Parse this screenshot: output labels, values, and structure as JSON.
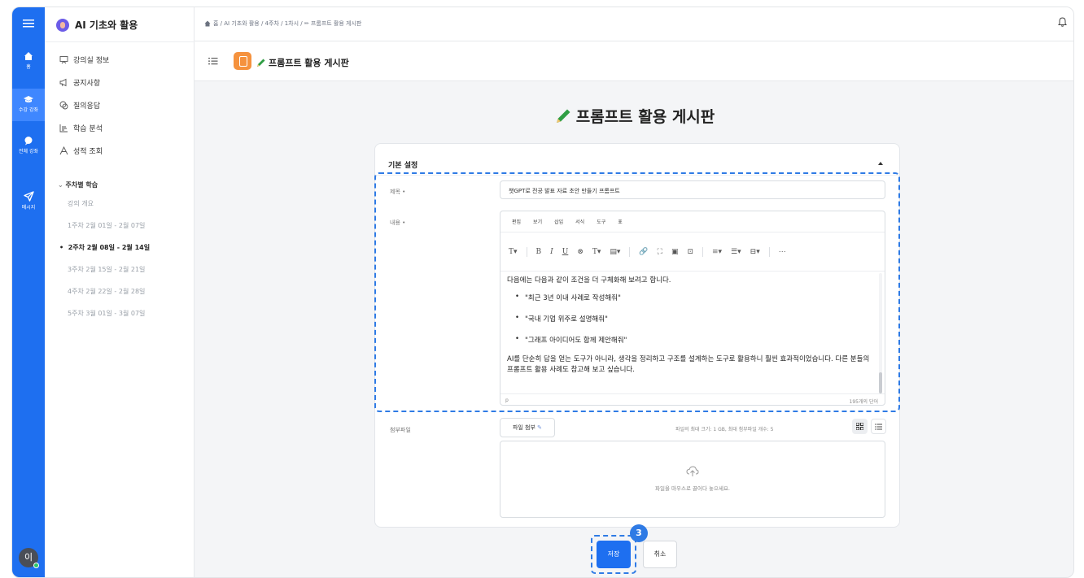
{
  "rail": {
    "items": [
      {
        "icon": "menu-icon",
        "label": ""
      },
      {
        "icon": "home-icon",
        "label": "홈"
      },
      {
        "icon": "graduation-cap-icon",
        "label": "수강 강좌"
      },
      {
        "icon": "chat-icon",
        "label": "전체 강좌"
      },
      {
        "icon": "send-icon",
        "label": "메시지"
      }
    ],
    "avatar_initial": "이"
  },
  "sidebar": {
    "course_title": "AI 기초와 활용",
    "menu": [
      {
        "icon": "classroom-icon",
        "label": "강의실 정보"
      },
      {
        "icon": "megaphone-icon",
        "label": "공지사항"
      },
      {
        "icon": "qa-icon",
        "label": "질의응답"
      },
      {
        "icon": "analytics-icon",
        "label": "학습 분석"
      },
      {
        "icon": "grade-icon",
        "label": "성적 조회"
      }
    ],
    "week_heading": "주차별 학습",
    "weeks": [
      {
        "label": "강의 개요",
        "current": false
      },
      {
        "label": "1주차 2월 01일 - 2월 07일",
        "current": false
      },
      {
        "label": "2주차 2월 08일 - 2월 14일",
        "current": true
      },
      {
        "label": "3주차 2월 15일 - 2월 21일",
        "current": false
      },
      {
        "label": "4주차 2월 22일 - 2월 28일",
        "current": false
      },
      {
        "label": "5주차 3월 01일 - 3월 07일",
        "current": false
      }
    ]
  },
  "topbar": {
    "breadcrumb": "홈 / AI 기초와 활용 / 4주차 / 1차시 / ✏ 프롬프트 활용 게시판"
  },
  "board": {
    "name": "프롬프트 활용 게시판",
    "page_title": "프롬프트 활용 게시판"
  },
  "form": {
    "section_title": "기본 설정",
    "title_label": "제목",
    "title_value": "챗GPT로 전공 발표 자료 초안 만들기 프롬프트",
    "content_label": "내용",
    "editor_menu": [
      "편집",
      "보기",
      "삽입",
      "서식",
      "도구",
      "표"
    ],
    "editor_toolbar": [
      "T▾",
      "B",
      "I",
      "U",
      "⊗",
      "T▾",
      "▤▾",
      "🔗",
      "⛶",
      "▣",
      "⊡",
      "≡▾",
      "☰▾",
      "⊟▾",
      "⋯"
    ],
    "content_intro": "다음에는 다음과 같이 조건을 더 구체화해 보려고 합니다.",
    "content_bullets": [
      "\"최근 3년 이내 사례로 작성해줘\"",
      "\"국내 기업 위주로 설명해줘\"",
      "\"그래프 아이디어도 함께 제안해줘\""
    ],
    "content_closing": "AI를 단순히 답을 얻는 도구가 아니라, 생각을 정리하고 구조를 설계하는 도구로 활용하니 훨씬 효과적이었습니다. 다른 분들의 프롬프트 활용 사례도 참고해 보고 싶습니다.",
    "editor_path": "p",
    "word_count": "195개의 단어",
    "attachment_label": "첨부파일",
    "attach_button": "파일 첨부",
    "attach_info": "파일의 최대 크기: 1 GB, 최대 첨부파일 개수: 5",
    "dropzone_text": "파일을 마우스로 끌어다 놓으세요."
  },
  "actions": {
    "save": "저장",
    "cancel": "취소",
    "step_number": "3"
  },
  "colors": {
    "primary": "#1e6ff0",
    "highlight_dash": "#2f7be5",
    "board_badge": "#f5923e"
  }
}
